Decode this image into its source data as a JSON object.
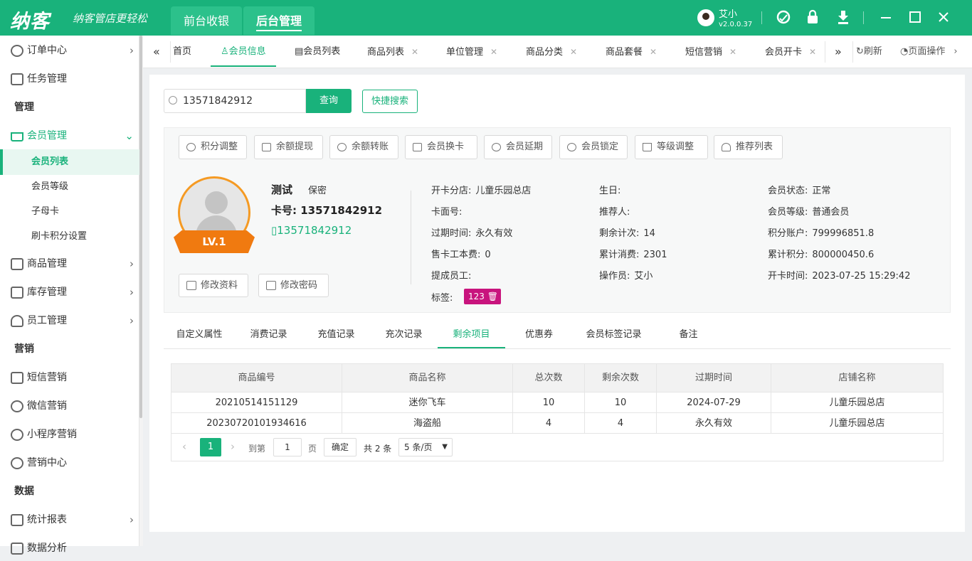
{
  "app": {
    "logo": "纳客",
    "slogan": "纳客管店更轻松",
    "nav_front": "前台收银",
    "nav_back": "后台管理",
    "user_name": "艾小",
    "version": "v2.0.0.37"
  },
  "icons": {
    "accent": "#19b27b",
    "support": "headset-icon",
    "lock": "lock-icon",
    "download": "download-icon",
    "min": "minimize-icon",
    "max": "maximize-icon",
    "close": "close-icon"
  },
  "sidebar": {
    "items": [
      {
        "label": "订单中心",
        "icon": "order-icon"
      },
      {
        "label": "任务管理",
        "icon": "task-icon"
      },
      {
        "label": "管理"
      },
      {
        "label": "会员管理",
        "icon": "crown-icon"
      },
      {
        "label": "会员列表"
      },
      {
        "label": "会员等级"
      },
      {
        "label": "子母卡"
      },
      {
        "label": "刷卡积分设置"
      },
      {
        "label": "商品管理",
        "icon": "goods-icon"
      },
      {
        "label": "库存管理",
        "icon": "stock-icon"
      },
      {
        "label": "员工管理",
        "icon": "staff-icon"
      },
      {
        "label": "营销"
      },
      {
        "label": "短信营销",
        "icon": "mail-icon"
      },
      {
        "label": "微信营销",
        "icon": "wechat-icon"
      },
      {
        "label": "小程序营销",
        "icon": "miniapp-icon"
      },
      {
        "label": "营销中心",
        "icon": "target-icon"
      },
      {
        "label": "数据"
      },
      {
        "label": "统计报表",
        "icon": "chart-icon"
      },
      {
        "label": "数据分析",
        "icon": "analysis-icon"
      }
    ]
  },
  "tabs": {
    "items": [
      "首页",
      "会员信息",
      "会员列表",
      "商品列表",
      "单位管理",
      "商品分类",
      "商品套餐",
      "短信营销",
      "会员开卡"
    ],
    "refresh": "刷新",
    "page_ops": "页面操作"
  },
  "search": {
    "value": "13571842912",
    "query_btn": "查询",
    "quick_btn": "快捷搜索"
  },
  "actions": [
    "积分调整",
    "余额提现",
    "余额转账",
    "会员换卡",
    "会员延期",
    "会员锁定",
    "等级调整",
    "推荐列表"
  ],
  "member": {
    "level": "LV.1",
    "name": "测试",
    "gender": "保密",
    "card_label": "卡号:",
    "card_no": "13571842912",
    "phone": "13571842912",
    "edit_btn": "修改资料",
    "pwd_btn": "修改密码",
    "fields": {
      "c1": [
        [
          "开卡分店:",
          "儿童乐园总店"
        ],
        [
          "卡面号:",
          ""
        ],
        [
          "过期时间:",
          "永久有效"
        ],
        [
          "售卡工本费:",
          "0"
        ],
        [
          "提成员工:",
          ""
        ]
      ],
      "tag_label": "标签:",
      "tag_value": "123",
      "c2": [
        [
          "生日:",
          ""
        ],
        [
          "推荐人:",
          ""
        ],
        [
          "剩余计次:",
          "14"
        ],
        [
          "累计消费:",
          "2301"
        ],
        [
          "操作员:",
          "艾小"
        ]
      ],
      "c3": [
        [
          "会员状态:",
          "正常"
        ],
        [
          "会员等级:",
          "普通会员"
        ],
        [
          "积分账户:",
          "799996851.8"
        ],
        [
          "累计积分:",
          "800000450.6"
        ],
        [
          "开卡时间:",
          "2023-07-25 15:29:42"
        ]
      ]
    }
  },
  "subtabs": [
    "自定义属性",
    "消费记录",
    "充值记录",
    "充次记录",
    "剩余项目",
    "优惠券",
    "会员标签记录",
    "备注"
  ],
  "table": {
    "headers": [
      "商品编号",
      "商品名称",
      "总次数",
      "剩余次数",
      "过期时间",
      "店铺名称"
    ],
    "rows": [
      [
        "20210514151129",
        "迷你飞车",
        "10",
        "10",
        "2024-07-29",
        "儿童乐园总店"
      ],
      [
        "20230720101934616",
        "海盗船",
        "4",
        "4",
        "永久有效",
        "儿童乐园总店"
      ]
    ]
  },
  "pager": {
    "current": "1",
    "goto_label": "到第",
    "goto_value": "1",
    "page_unit": "页",
    "confirm": "确定",
    "total": "共 2 条",
    "size": "5 条/页"
  }
}
